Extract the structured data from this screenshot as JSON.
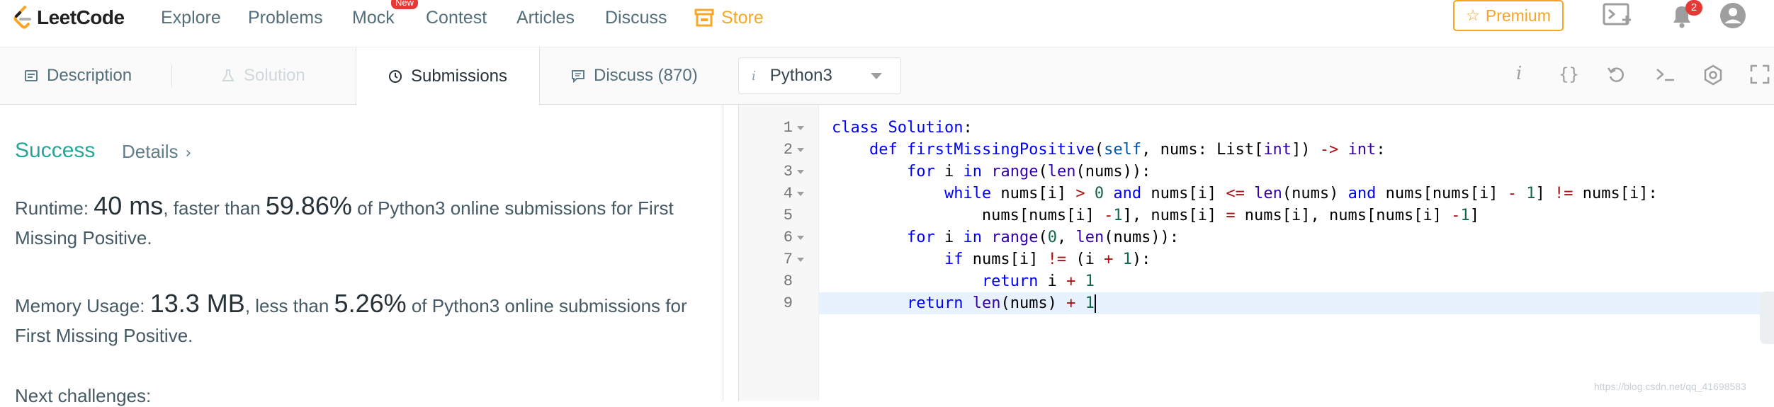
{
  "nav": {
    "logo": "LeetCode",
    "items": [
      {
        "label": "Explore"
      },
      {
        "label": "Problems"
      },
      {
        "label": "Mock"
      },
      {
        "label": "Contest"
      },
      {
        "label": "Articles"
      },
      {
        "label": "Discuss"
      }
    ],
    "mock_badge": "New",
    "store": "Store",
    "premium": "Premium",
    "premium_star": "☆",
    "notification_count": "2"
  },
  "tabs": {
    "description": "Description",
    "solution": "Solution",
    "submissions": "Submissions",
    "discuss": "Discuss (870)"
  },
  "editor_toolbar": {
    "language": "Python3",
    "lang_icon": "i",
    "info_icon": "i",
    "braces_icon": "{}"
  },
  "result": {
    "status": "Success",
    "details": "Details",
    "details_chevron": "›",
    "runtime_label": "Runtime: ",
    "runtime_value": "40 ms",
    "runtime_mid": ", faster than ",
    "runtime_pct": "59.86%",
    "runtime_tail": " of Python3 online submissions for First Missing Positive.",
    "memory_label": "Memory Usage: ",
    "memory_value": "13.3 MB",
    "memory_mid": ", less than ",
    "memory_pct": "5.26%",
    "memory_tail": " of Python3 online submissions for First Missing Positive.",
    "next_partial": "Next challenges:"
  },
  "code": {
    "line_numbers": [
      "1",
      "2",
      "3",
      "4",
      "5",
      "6",
      "7",
      "8",
      "9"
    ],
    "lines": [
      "class Solution:",
      "    def firstMissingPositive(self, nums: List[int]) -> int:",
      "        for i in range(len(nums)):",
      "            while nums[i] > 0 and nums[i] <= len(nums) and nums[nums[i] - 1] != nums[i]:",
      "                nums[nums[i] -1], nums[i] = nums[i], nums[nums[i] -1]",
      "        for i in range(0, len(nums)):",
      "            if nums[i] != (i + 1):",
      "                return i + 1",
      "        return len(nums) + 1"
    ]
  },
  "watermark": "https://blog.csdn.net/qq_41698583"
}
